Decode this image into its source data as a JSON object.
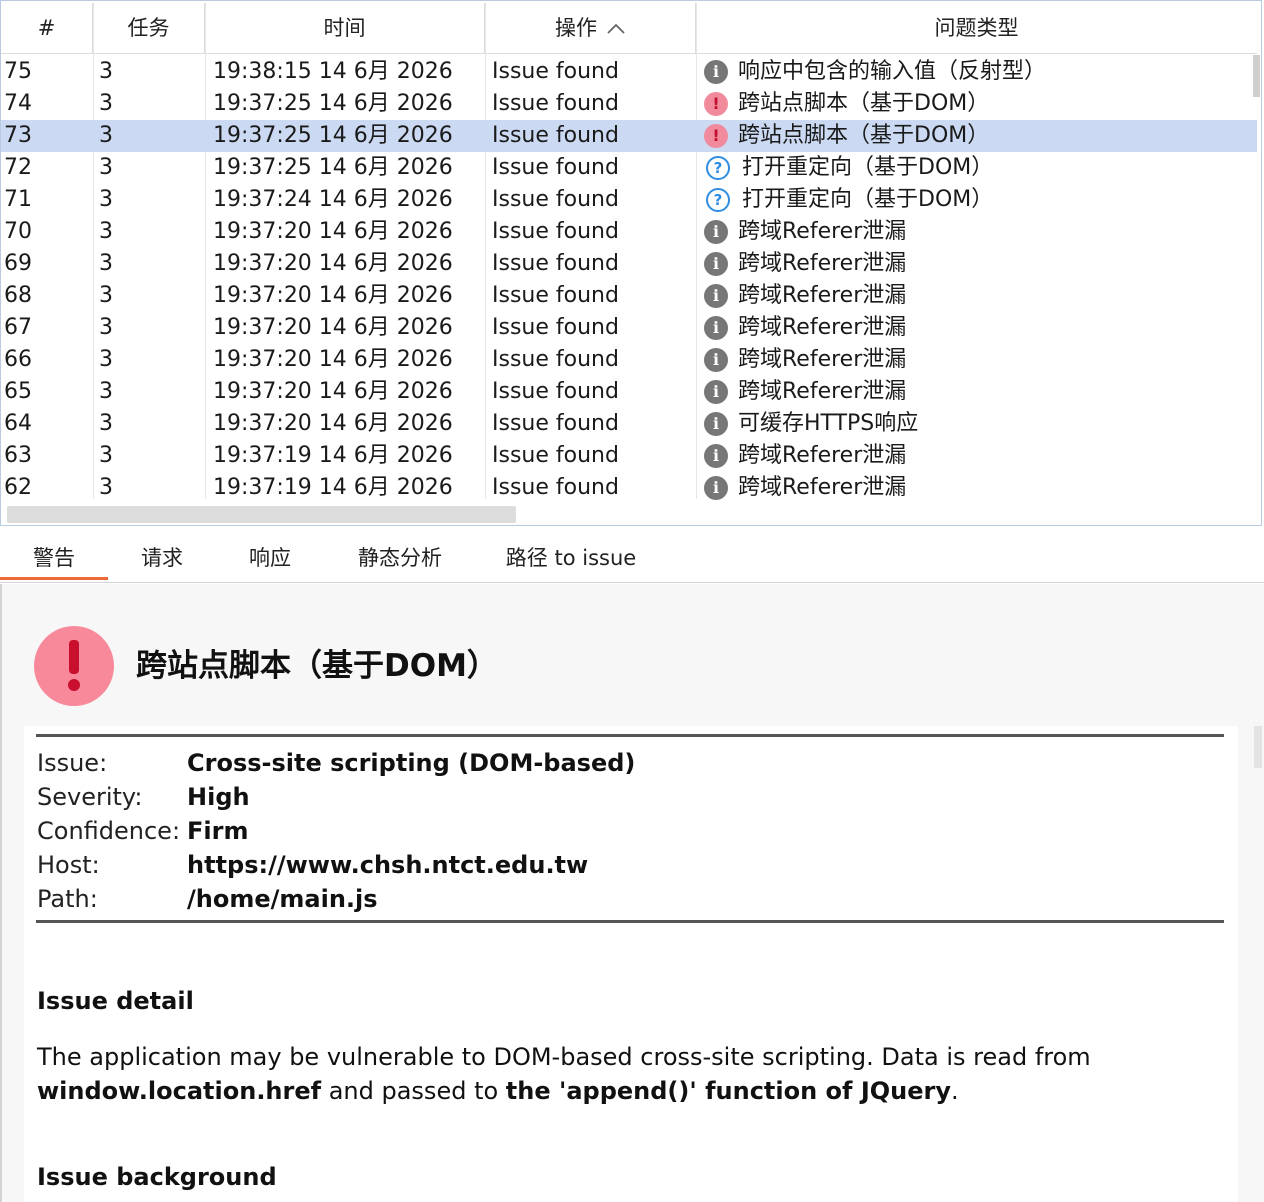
{
  "table": {
    "columns": [
      {
        "label": "#"
      },
      {
        "label": "任务"
      },
      {
        "label": "时间"
      },
      {
        "label": "操作",
        "sorted": "ascending"
      },
      {
        "label": "问题类型"
      }
    ],
    "rows": [
      {
        "num": "75",
        "task": "3",
        "time": "19:38:15 14 6月 2026",
        "op": "Issue found",
        "icon": "info-icon",
        "type": "响应中包含的输入值（反射型）",
        "selected": false
      },
      {
        "num": "74",
        "task": "3",
        "time": "19:37:25 14 6月 2026",
        "op": "Issue found",
        "icon": "high-severity-icon",
        "type": "跨站点脚本（基于DOM）",
        "selected": false
      },
      {
        "num": "73",
        "task": "3",
        "time": "19:37:25 14 6月 2026",
        "op": "Issue found",
        "icon": "high-severity-icon",
        "type": "跨站点脚本（基于DOM）",
        "selected": true
      },
      {
        "num": "72",
        "task": "3",
        "time": "19:37:25 14 6月 2026",
        "op": "Issue found",
        "icon": "tentative-icon",
        "type": "打开重定向（基于DOM）",
        "selected": false
      },
      {
        "num": "71",
        "task": "3",
        "time": "19:37:24 14 6月 2026",
        "op": "Issue found",
        "icon": "tentative-icon",
        "type": "打开重定向（基于DOM）",
        "selected": false
      },
      {
        "num": "70",
        "task": "3",
        "time": "19:37:20 14 6月 2026",
        "op": "Issue found",
        "icon": "info-icon",
        "type": "跨域Referer泄漏",
        "selected": false
      },
      {
        "num": "69",
        "task": "3",
        "time": "19:37:20 14 6月 2026",
        "op": "Issue found",
        "icon": "info-icon",
        "type": "跨域Referer泄漏",
        "selected": false
      },
      {
        "num": "68",
        "task": "3",
        "time": "19:37:20 14 6月 2026",
        "op": "Issue found",
        "icon": "info-icon",
        "type": "跨域Referer泄漏",
        "selected": false
      },
      {
        "num": "67",
        "task": "3",
        "time": "19:37:20 14 6月 2026",
        "op": "Issue found",
        "icon": "info-icon",
        "type": "跨域Referer泄漏",
        "selected": false
      },
      {
        "num": "66",
        "task": "3",
        "time": "19:37:20 14 6月 2026",
        "op": "Issue found",
        "icon": "info-icon",
        "type": "跨域Referer泄漏",
        "selected": false
      },
      {
        "num": "65",
        "task": "3",
        "time": "19:37:20 14 6月 2026",
        "op": "Issue found",
        "icon": "info-icon",
        "type": "跨域Referer泄漏",
        "selected": false
      },
      {
        "num": "64",
        "task": "3",
        "time": "19:37:20 14 6月 2026",
        "op": "Issue found",
        "icon": "info-icon",
        "type": "可缓存HTTPS响应",
        "selected": false
      },
      {
        "num": "63",
        "task": "3",
        "time": "19:37:19 14 6月 2026",
        "op": "Issue found",
        "icon": "info-icon",
        "type": "跨域Referer泄漏",
        "selected": false
      },
      {
        "num": "62",
        "task": "3",
        "time": "19:37:19 14 6月 2026",
        "op": "Issue found",
        "icon": "info-icon",
        "type": "跨域Referer泄漏",
        "selected": false
      }
    ]
  },
  "tabs": [
    {
      "label": "警告",
      "active": true
    },
    {
      "label": "请求",
      "active": false
    },
    {
      "label": "响应",
      "active": false
    },
    {
      "label": "静态分析",
      "active": false
    },
    {
      "label": "路径 to issue",
      "active": false
    }
  ],
  "detail": {
    "title_icon": "high-severity-icon",
    "title": "跨站点脚本（基于DOM）",
    "fields": [
      {
        "key": "Issue:",
        "value": "Cross-site scripting (DOM-based)"
      },
      {
        "key": "Severity:",
        "value": "High"
      },
      {
        "key": "Confidence:",
        "value": "Firm"
      },
      {
        "key": "Host:",
        "value": "https://www.chsh.ntct.edu.tw"
      },
      {
        "key": "Path:",
        "value": "/home/main.js"
      }
    ],
    "issue_detail_heading": "Issue detail",
    "issue_detail": {
      "text1": "The application may be vulnerable to DOM-based cross-site scripting. Data is read from ",
      "bold1": "window.location.href",
      "text2": " and passed to ",
      "bold2": "the 'append()' function of JQuery",
      "text3": "."
    },
    "issue_background_heading": "Issue background"
  },
  "colors": {
    "selected_row": "#cbdaf2",
    "high_severity": "#f7899b",
    "tab_accent": "#ec6a37",
    "info_icon": "#777777",
    "tentative_icon": "#2e8de0"
  }
}
